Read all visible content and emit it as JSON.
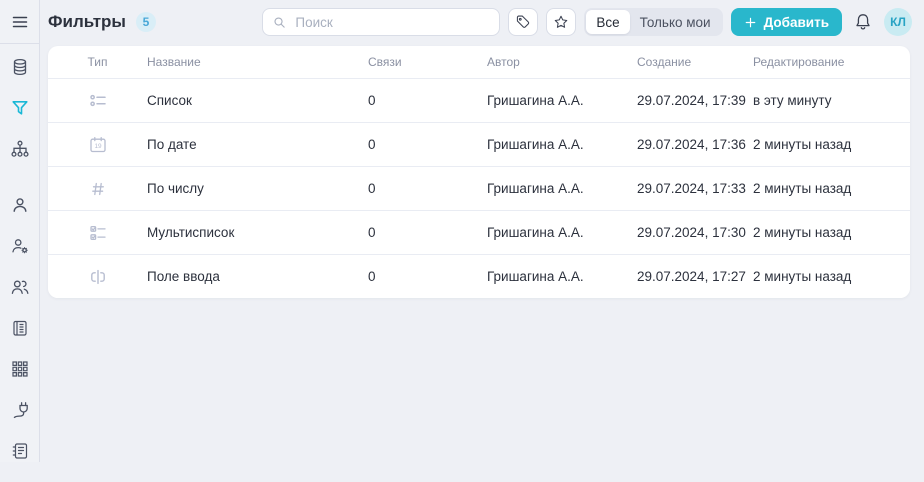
{
  "colors": {
    "accent": "#29b7cc",
    "active_icon": "#1ab8d6",
    "badge_bg": "#d9eef7",
    "badge_text": "#49a8d8",
    "avatar_bg": "#c9ebf2",
    "avatar_text": "#27a3c4",
    "page_bg": "#eef0f5"
  },
  "header": {
    "title": "Фильтры",
    "badge_count": "5"
  },
  "topbar": {
    "search_placeholder": "Поиск",
    "filter_all": "Все",
    "filter_mine": "Только мои",
    "add_button": "Добавить",
    "avatar_initials": "КЛ"
  },
  "sidebar": {
    "icons": [
      "menu-icon",
      "database-icon",
      "filter-icon",
      "hierarchy-icon",
      "user-icon",
      "user-settings-icon",
      "users-icon",
      "book-icon",
      "apps-grid-icon",
      "plug-icon",
      "journal-icon"
    ],
    "active": "filter-icon"
  },
  "table": {
    "columns": [
      "Тип",
      "Название",
      "Связи",
      "Автор",
      "Создание",
      "Редактирование"
    ],
    "rows": [
      {
        "type_icon": "list-type-icon",
        "name": "Список",
        "links": "0",
        "author": "Гришагина А.А.",
        "created": "29.07.2024, 17:39",
        "edited": "в эту минуту"
      },
      {
        "type_icon": "calendar-type-icon",
        "name": "По дате",
        "links": "0",
        "author": "Гришагина А.А.",
        "created": "29.07.2024, 17:36",
        "edited": "2 минуты назад"
      },
      {
        "type_icon": "number-type-icon",
        "name": "По числу",
        "links": "0",
        "author": "Гришагина А.А.",
        "created": "29.07.2024, 17:33",
        "edited": "2 минуты назад"
      },
      {
        "type_icon": "multilist-type-icon",
        "name": "Мультисписок",
        "links": "0",
        "author": "Гришагина А.А.",
        "created": "29.07.2024, 17:30",
        "edited": "2 минуты назад"
      },
      {
        "type_icon": "input-type-icon",
        "name": "Поле ввода",
        "links": "0",
        "author": "Гришагина А.А.",
        "created": "29.07.2024, 17:27",
        "edited": "2 минуты назад"
      }
    ]
  }
}
